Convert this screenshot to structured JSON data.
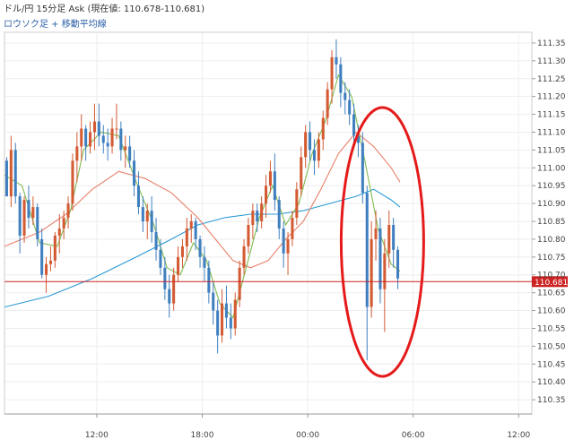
{
  "header": {
    "title": "ドル/円 15分足 Ask (現在値: 110.678-110.681)",
    "subtitle": "ロウソク足 + 移動平均線"
  },
  "colors": {
    "up": "#d35a32",
    "down": "#3f7fbf",
    "ma_short": "#7fba4e",
    "ma_mid": "#e8806a",
    "ma_long": "#2a9ad6",
    "current_line": "#cc2222",
    "highlight": "#e51a1a",
    "grid": "#eeeeee"
  },
  "chart_data": {
    "type": "candlestick",
    "y_ticks": [
      "111.35",
      "111.30",
      "111.25",
      "111.20",
      "111.15",
      "111.10",
      "111.05",
      "111.00",
      "110.95",
      "110.90",
      "110.85",
      "110.80",
      "110.75",
      "110.70",
      "110.65",
      "110.60",
      "110.55",
      "110.50",
      "110.45",
      "110.40",
      "110.35"
    ],
    "ylim": [
      110.31,
      111.38
    ],
    "x_ticks": [
      {
        "label": "12:00",
        "t": 21
      },
      {
        "label": "18:00",
        "t": 45
      },
      {
        "label": "00:00",
        "t": 69
      },
      {
        "label": "06:00",
        "t": 93
      },
      {
        "label": "12:00",
        "t": 117
      }
    ],
    "xlim": [
      0,
      120
    ],
    "current_price": {
      "label": "110.681",
      "value": 110.681
    },
    "candles": [
      [
        111.02,
        111.03,
        110.96,
        110.92
      ],
      [
        110.92,
        111.09,
        110.89,
        111.05
      ],
      [
        111.05,
        111.07,
        110.9,
        110.92
      ],
      [
        110.92,
        110.93,
        110.76,
        110.81
      ],
      [
        110.81,
        110.92,
        110.79,
        110.91
      ],
      [
        110.91,
        110.95,
        110.83,
        110.86
      ],
      [
        110.86,
        110.92,
        110.84,
        110.89
      ],
      [
        110.89,
        110.9,
        110.78,
        110.8
      ],
      [
        110.8,
        110.83,
        110.69,
        110.7
      ],
      [
        110.7,
        110.75,
        110.65,
        110.73
      ],
      [
        110.73,
        110.78,
        110.71,
        110.74
      ],
      [
        110.74,
        110.82,
        110.72,
        110.81
      ],
      [
        110.81,
        110.87,
        110.76,
        110.83
      ],
      [
        110.83,
        110.88,
        110.8,
        110.86
      ],
      [
        110.86,
        110.92,
        110.83,
        110.9
      ],
      [
        110.9,
        111.04,
        110.88,
        111.02
      ],
      [
        111.02,
        111.1,
        110.96,
        111.06
      ],
      [
        111.06,
        111.15,
        111.02,
        111.11
      ],
      [
        111.11,
        111.12,
        111.02,
        111.06
      ],
      [
        111.06,
        111.13,
        111.04,
        111.1
      ],
      [
        111.1,
        111.18,
        111.05,
        111.13
      ],
      [
        111.13,
        111.18,
        111.06,
        111.09
      ],
      [
        111.09,
        111.12,
        111.04,
        111.07
      ],
      [
        111.07,
        111.11,
        111.02,
        111.06
      ],
      [
        111.06,
        111.14,
        111.04,
        111.11
      ],
      [
        111.11,
        111.18,
        111.08,
        111.11
      ],
      [
        111.11,
        111.13,
        111.02,
        111.05
      ],
      [
        111.05,
        111.09,
        111.0,
        111.06
      ],
      [
        111.06,
        111.09,
        111.0,
        111.02
      ],
      [
        111.02,
        111.05,
        110.92,
        110.95
      ],
      [
        110.95,
        110.99,
        110.87,
        110.89
      ],
      [
        110.89,
        110.92,
        110.82,
        110.85
      ],
      [
        110.85,
        110.9,
        110.8,
        110.88
      ],
      [
        110.88,
        110.92,
        110.79,
        110.82
      ],
      [
        110.82,
        110.86,
        110.74,
        110.77
      ],
      [
        110.77,
        110.8,
        110.7,
        110.72
      ],
      [
        110.72,
        110.75,
        110.63,
        110.66
      ],
      [
        110.66,
        110.7,
        110.58,
        110.62
      ],
      [
        110.62,
        110.72,
        110.6,
        110.7
      ],
      [
        110.7,
        110.78,
        110.68,
        110.75
      ],
      [
        110.75,
        110.8,
        110.72,
        110.78
      ],
      [
        110.78,
        110.86,
        110.74,
        110.83
      ],
      [
        110.83,
        110.87,
        110.79,
        110.85
      ],
      [
        110.85,
        110.86,
        110.77,
        110.8
      ],
      [
        110.8,
        110.81,
        110.72,
        110.75
      ],
      [
        110.75,
        110.78,
        110.68,
        110.72
      ],
      [
        110.72,
        110.74,
        110.62,
        110.65
      ],
      [
        110.65,
        110.68,
        110.56,
        110.6
      ],
      [
        110.6,
        110.63,
        110.48,
        110.53
      ],
      [
        110.53,
        110.66,
        110.51,
        110.62
      ],
      [
        110.62,
        110.67,
        110.55,
        110.58
      ],
      [
        110.58,
        110.62,
        110.52,
        110.55
      ],
      [
        110.55,
        110.65,
        110.53,
        110.63
      ],
      [
        110.63,
        110.74,
        110.61,
        110.72
      ],
      [
        110.72,
        110.8,
        110.7,
        110.78
      ],
      [
        110.78,
        110.86,
        110.76,
        110.84
      ],
      [
        110.84,
        110.9,
        110.8,
        110.88
      ],
      [
        110.88,
        110.9,
        110.82,
        110.85
      ],
      [
        110.85,
        110.92,
        110.83,
        110.9
      ],
      [
        110.9,
        110.98,
        110.86,
        110.95
      ],
      [
        110.95,
        111.02,
        110.93,
        110.99
      ],
      [
        110.99,
        111.04,
        110.88,
        110.91
      ],
      [
        110.91,
        110.92,
        110.8,
        110.83
      ],
      [
        110.83,
        110.85,
        110.72,
        110.76
      ],
      [
        110.76,
        110.82,
        110.7,
        110.8
      ],
      [
        110.8,
        110.88,
        110.78,
        110.86
      ],
      [
        110.86,
        110.96,
        110.84,
        110.94
      ],
      [
        110.94,
        111.06,
        110.92,
        111.03
      ],
      [
        111.03,
        111.12,
        111.0,
        111.1
      ],
      [
        111.1,
        111.13,
        111.02,
        111.05
      ],
      [
        111.05,
        111.08,
        110.98,
        111.02
      ],
      [
        111.02,
        111.1,
        111.0,
        111.08
      ],
      [
        111.08,
        111.16,
        111.05,
        111.14
      ],
      [
        111.14,
        111.24,
        111.12,
        111.22
      ],
      [
        111.22,
        111.33,
        111.18,
        111.31
      ],
      [
        111.31,
        111.36,
        111.25,
        111.29
      ],
      [
        111.29,
        111.31,
        111.17,
        111.21
      ],
      [
        111.21,
        111.24,
        111.15,
        111.19
      ],
      [
        111.19,
        111.22,
        111.12,
        111.15
      ],
      [
        111.15,
        111.18,
        111.06,
        111.09
      ],
      [
        111.09,
        111.12,
        111.03,
        111.07
      ],
      [
        111.07,
        111.1,
        110.9,
        110.93
      ],
      [
        110.93,
        110.95,
        110.46,
        110.61
      ],
      [
        110.61,
        110.85,
        110.58,
        110.8
      ],
      [
        110.8,
        110.88,
        110.74,
        110.83
      ],
      [
        110.83,
        110.86,
        110.62,
        110.66
      ],
      [
        110.66,
        110.8,
        110.54,
        110.76
      ],
      [
        110.76,
        110.88,
        110.72,
        110.84
      ],
      [
        110.84,
        110.86,
        110.72,
        110.77
      ],
      [
        110.77,
        110.78,
        110.66,
        110.69
      ]
    ],
    "ma_short": [
      [
        0,
        110.98
      ],
      [
        4,
        110.95
      ],
      [
        8,
        110.79
      ],
      [
        12,
        110.78
      ],
      [
        15,
        110.88
      ],
      [
        18,
        111.05
      ],
      [
        22,
        111.1
      ],
      [
        26,
        111.09
      ],
      [
        30,
        110.96
      ],
      [
        34,
        110.84
      ],
      [
        37,
        110.72
      ],
      [
        40,
        110.7
      ],
      [
        43,
        110.79
      ],
      [
        46,
        110.74
      ],
      [
        49,
        110.62
      ],
      [
        52,
        110.58
      ],
      [
        55,
        110.72
      ],
      [
        58,
        110.86
      ],
      [
        61,
        110.95
      ],
      [
        64,
        110.84
      ],
      [
        67,
        110.9
      ],
      [
        70,
        111.04
      ],
      [
        73,
        111.13
      ],
      [
        76,
        111.26
      ],
      [
        79,
        111.2
      ],
      [
        82,
        111.02
      ],
      [
        85,
        110.83
      ],
      [
        88,
        110.73
      ],
      [
        90,
        110.71
      ]
    ],
    "ma_mid": [
      [
        0,
        110.78
      ],
      [
        8,
        110.82
      ],
      [
        14,
        110.87
      ],
      [
        20,
        110.94
      ],
      [
        26,
        110.99
      ],
      [
        32,
        110.97
      ],
      [
        38,
        110.93
      ],
      [
        44,
        110.86
      ],
      [
        48,
        110.8
      ],
      [
        52,
        110.74
      ],
      [
        56,
        110.72
      ],
      [
        60,
        110.74
      ],
      [
        64,
        110.8
      ],
      [
        68,
        110.85
      ],
      [
        72,
        110.94
      ],
      [
        76,
        111.04
      ],
      [
        80,
        111.1
      ],
      [
        84,
        111.06
      ],
      [
        88,
        111.0
      ],
      [
        90,
        110.96
      ]
    ],
    "ma_long": [
      [
        0,
        110.61
      ],
      [
        10,
        110.64
      ],
      [
        20,
        110.69
      ],
      [
        30,
        110.75
      ],
      [
        38,
        110.8
      ],
      [
        44,
        110.84
      ],
      [
        50,
        110.86
      ],
      [
        56,
        110.87
      ],
      [
        62,
        110.87
      ],
      [
        68,
        110.88
      ],
      [
        74,
        110.9
      ],
      [
        80,
        110.92
      ],
      [
        84,
        110.94
      ],
      [
        88,
        110.91
      ],
      [
        90,
        110.89
      ]
    ]
  }
}
